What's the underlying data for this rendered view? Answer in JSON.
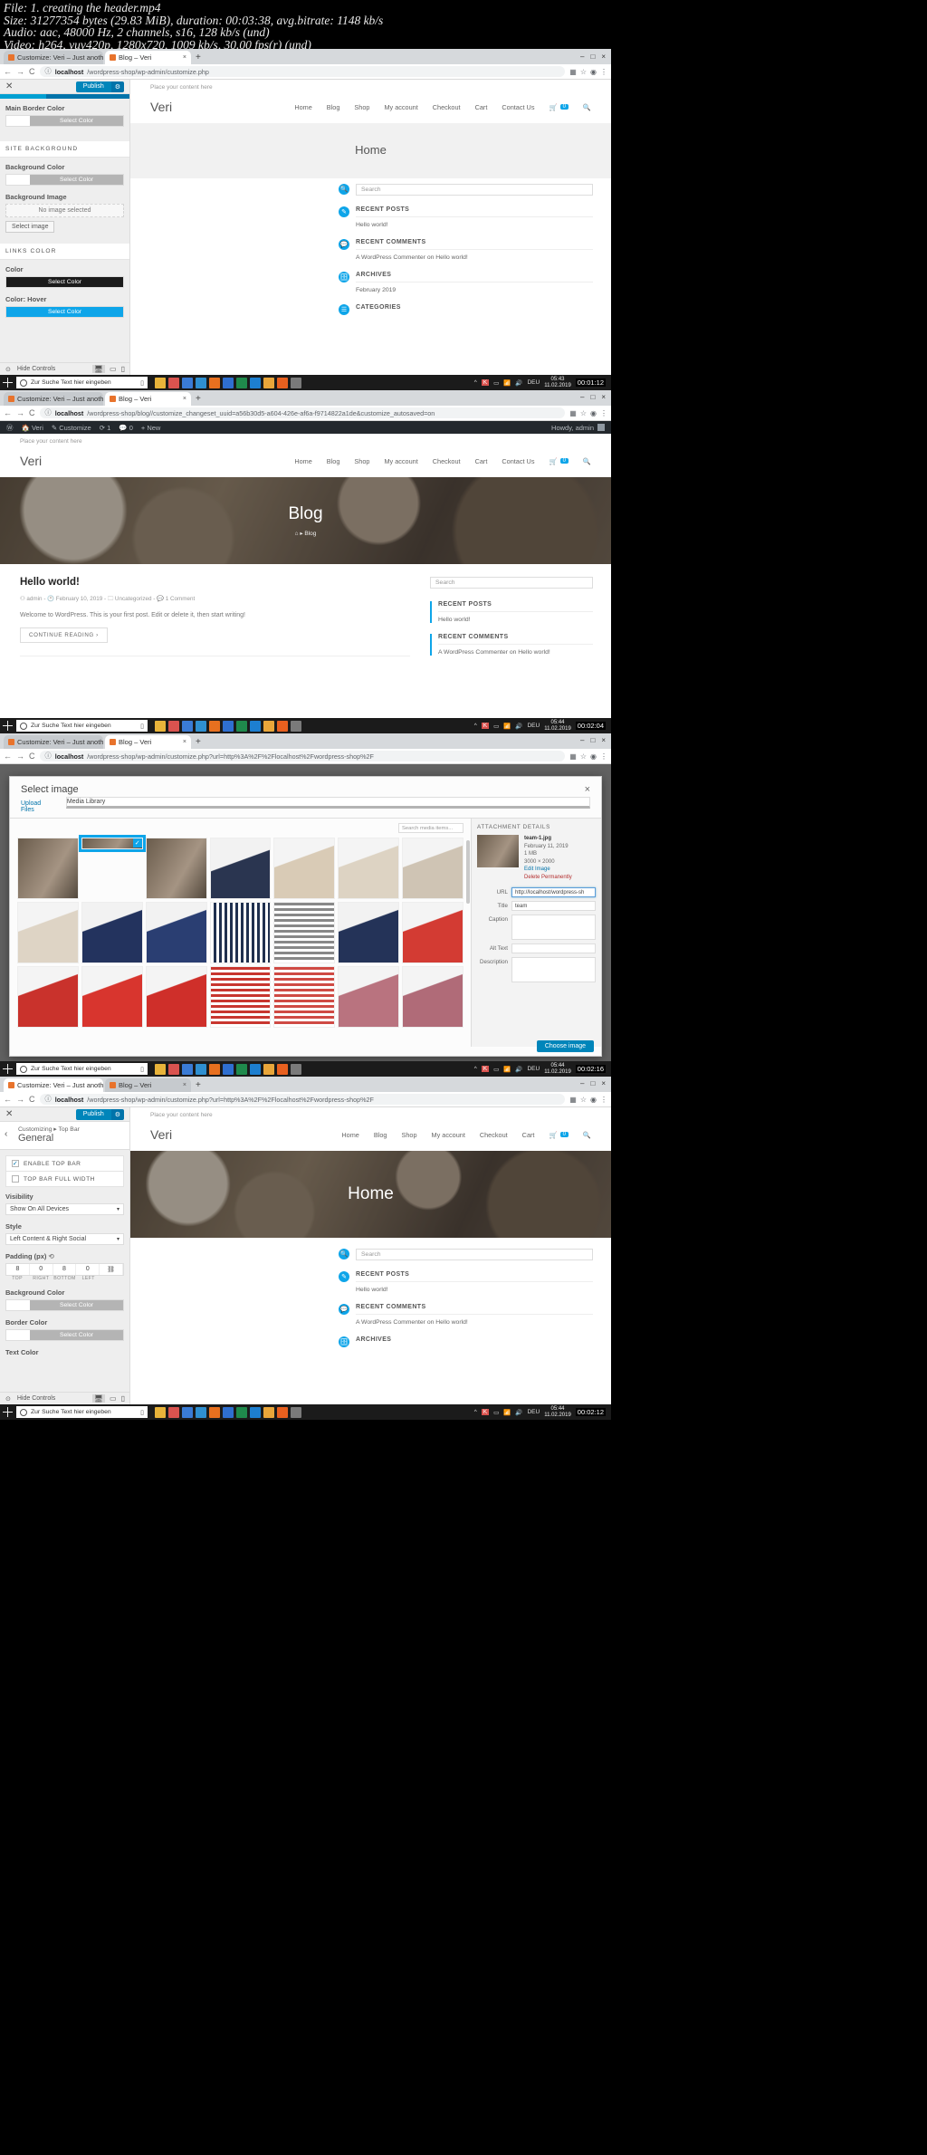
{
  "fileinfo": {
    "line1": "File: 1. creating the header.mp4",
    "line2": "Size: 31277354 bytes (29.83 MiB), duration: 00:03:38, avg.bitrate: 1148 kb/s",
    "line3": "Audio: aac, 48000 Hz, 2 channels, s16, 128 kb/s (und)",
    "line4": "Video: h264, yuv420p, 1280x720, 1009 kb/s, 30.00 fps(r) (und)"
  },
  "colors": {
    "wp_blue": "#0085ba",
    "accent_cyan": "#0ea5e9",
    "admin_bar": "#23282d",
    "taskbar": "#1b1b1b",
    "delete_red": "#b32d2e"
  },
  "browser": {
    "tab1": "Customize: Veri – Just another W",
    "tab2": "Blog – Veri",
    "tab_close": "×",
    "new_tab": "+",
    "back": "←",
    "forward": "→",
    "reload": "C",
    "win_min": "–",
    "win_max": "□",
    "win_close": "×",
    "url_panel1_host": "localhost",
    "url_panel1_path": "/wordpress-shop/wp-admin/customize.php",
    "url_panel2_host": "localhost",
    "url_panel2_path": "/wordpress-shop/blog//customize_changeset_uuid=a56b30d5-a604-426e-af6a-f9714822a1de&customize_autosaved=on",
    "url_panel3_host": "localhost",
    "url_panel3_path": "/wordpress-shop/wp-admin/customize.php?url=http%3A%2F%2Flocalhost%2Fwordpress-shop%2F",
    "url_panel4_host": "localhost",
    "url_panel4_path": "/wordpress-shop/wp-admin/customize.php?url=http%3A%2F%2Flocalhost%2Fwordpress-shop%2F",
    "info_icon": "ⓘ",
    "omni_icons": [
      "▦",
      "☆",
      "▣"
    ]
  },
  "wpadmin": {
    "logo": "Ⓦ",
    "site": "Veri",
    "customize": "Customize",
    "updates_icon": "⟳",
    "updates_count": "1",
    "comments_icon": "💬",
    "comments_count": "0",
    "new": "+ New",
    "howdy": "Howdy, admin"
  },
  "customizer_panel1": {
    "close": "✕",
    "publish": "Publish",
    "gear": "⚙",
    "fields": [
      {
        "label": "Main Border Color",
        "button": "Select Color",
        "swatch": "#ffffff",
        "btn_color": "#b4b4b4"
      }
    ],
    "section_site_background": "SITE BACKGROUND",
    "background_color_label": "Background Color",
    "background_color_button": "Select Color",
    "background_image_label": "Background Image",
    "no_image_selected": "No image selected",
    "select_image": "Select image",
    "section_links_color": "LINKS COLOR",
    "color_label": "Color",
    "color_button": "Select Color",
    "color_hover_label": "Color: Hover",
    "color_hover_button": "Select Color",
    "hide_controls": "Hide Controls",
    "devices": [
      "desktop",
      "tablet",
      "mobile"
    ]
  },
  "customizer_panel4": {
    "close": "✕",
    "publish": "Publish",
    "gear": "⚙",
    "back": "‹",
    "breadcrumb": "Customizing ▸ Top Bar",
    "title": "General",
    "checkbox_enable_top_bar": "ENABLE TOP BAR",
    "checkbox_top_bar_full_width": "TOP BAR FULL WIDTH",
    "enable_top_bar_checked": true,
    "top_bar_full_width_checked": false,
    "visibility_label": "Visibility",
    "visibility_value": "Show On All Devices",
    "style_label": "Style",
    "style_value": "Left Content & Right Social",
    "padding_label": "Padding (px)",
    "padding_values": [
      "8",
      "0",
      "8",
      "0"
    ],
    "padding_labels": [
      "TOP",
      "RIGHT",
      "BOTTOM",
      "LEFT"
    ],
    "link_icon": "⛓",
    "background_color_label": "Background Color",
    "background_color_button": "Select Color",
    "border_color_label": "Border Color",
    "border_color_button": "Select Color",
    "text_color_label": "Text Color",
    "hide_controls": "Hide Controls"
  },
  "site": {
    "placeholder_note": "Place your content here",
    "brand": "Veri",
    "nav": [
      "Home",
      "Blog",
      "Shop",
      "My account",
      "Checkout",
      "Cart",
      "Contact Us"
    ],
    "cart_icon": "🛒",
    "cart_count": "0",
    "search_icon": "🔍",
    "hero_home": "Home",
    "hero_blog": "Blog",
    "breadcrumb_blog": "⌂ ▸ Blog"
  },
  "widgets": {
    "search_placeholder": "Search",
    "recent_posts_title": "RECENT POSTS",
    "recent_posts_items": [
      "Hello world!"
    ],
    "recent_comments_title": "RECENT COMMENTS",
    "recent_comments_items": [
      "A WordPress Commenter on Hello world!"
    ],
    "archives_title": "ARCHIVES",
    "archives_items": [
      "February 2019"
    ],
    "categories_title": "CATEGORIES"
  },
  "post": {
    "title": "Hello world!",
    "meta_author": "admin",
    "meta_date": "February 10, 2019",
    "meta_category": "Uncategorized",
    "meta_comments": "1 Comment",
    "excerpt": "Welcome to WordPress. This is your first post. Edit or delete it, then start writing!",
    "read_more": "CONTINUE READING  ›"
  },
  "media_modal": {
    "title": "Select image",
    "close": "×",
    "tab_upload": "Upload Files",
    "tab_library": "Media Library",
    "search_placeholder": "Search media items...",
    "selected_tick": "✓",
    "attachment_details_title": "ATTACHMENT DETAILS",
    "filename": "team-1.jpg",
    "date": "February 11, 2019",
    "filesize": "1 MB",
    "dimensions": "3000 × 2000",
    "edit_image": "Edit Image",
    "delete_permanently": "Delete Permanently",
    "field_url_label": "URL",
    "field_url_value": "http://localhost/wordpress-sh",
    "field_title_label": "Title",
    "field_title_value": "team",
    "field_caption_label": "Caption",
    "field_caption_value": "",
    "field_alt_label": "Alt Text",
    "field_alt_value": "",
    "field_description_label": "Description",
    "field_description_value": "",
    "choose_image": "Choose image"
  },
  "taskbar": {
    "search_placeholder": "Zur Suche Text hier eingeben",
    "mic_icon": "🎤",
    "lang": "DEU",
    "clock_time_1": "05:43",
    "clock_date_1": "11.02.2019",
    "clock_time_2": "05:44",
    "clock_date_2": "11.02.2019",
    "timer_1": "00:01:12",
    "timer_2": "00:02:04",
    "timer_3": "00:02:16",
    "timer_4": "00:02:12"
  }
}
